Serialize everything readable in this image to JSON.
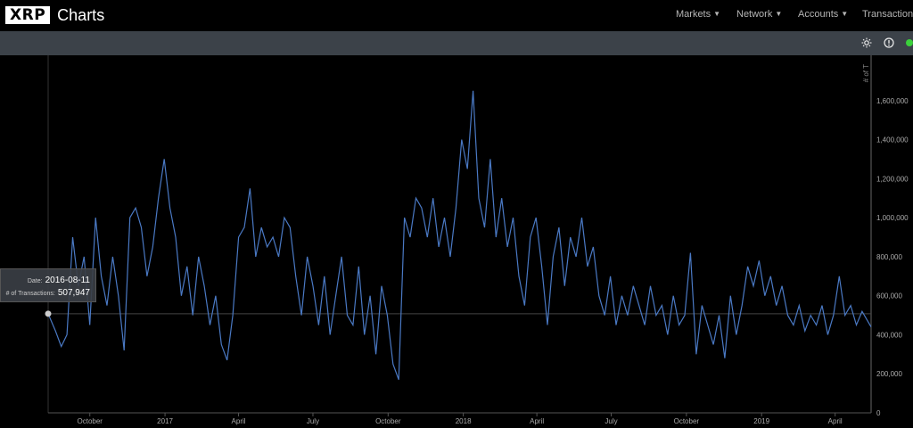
{
  "header": {
    "logo_mark": "XRP",
    "logo_text": "Charts",
    "nav": [
      {
        "label": "Markets"
      },
      {
        "label": "Network"
      },
      {
        "label": "Accounts"
      },
      {
        "label": "Transactions"
      }
    ]
  },
  "toolbar": {
    "icons": [
      "brightness-icon",
      "info-icon"
    ],
    "status_color": "#3bd13b"
  },
  "tooltip": {
    "date_label": "Date:",
    "date_value": "2016-08-11",
    "count_label": "# of Transactions:",
    "count_value": "507,947"
  },
  "chart_data": {
    "type": "line",
    "line_color": "#4a79c4",
    "ylabel": "# of T",
    "ylim": [
      0,
      1800000
    ],
    "y_ticks": [
      0,
      200000,
      400000,
      600000,
      800000,
      1000000,
      1200000,
      1400000,
      1600000
    ],
    "y_tick_labels": [
      "0",
      "200,000",
      "400,000",
      "600,000",
      "800,000",
      "1,000,000",
      "1,200,000",
      "1,400,000",
      "1,600,000"
    ],
    "xlim": [
      "2016-08-11",
      "2019-05-15"
    ],
    "x_ticks": [
      {
        "date": "2016-10-01",
        "label": "October"
      },
      {
        "date": "2017-01-01",
        "label": "2017"
      },
      {
        "date": "2017-04-01",
        "label": "April"
      },
      {
        "date": "2017-07-01",
        "label": "July"
      },
      {
        "date": "2017-10-01",
        "label": "October"
      },
      {
        "date": "2018-01-01",
        "label": "2018"
      },
      {
        "date": "2018-04-01",
        "label": "April"
      },
      {
        "date": "2018-07-01",
        "label": "July"
      },
      {
        "date": "2018-10-01",
        "label": "October"
      },
      {
        "date": "2019-01-01",
        "label": "2019"
      },
      {
        "date": "2019-04-01",
        "label": "April"
      }
    ],
    "crosshair": {
      "date": "2016-08-11",
      "value": 507947
    },
    "points": [
      [
        "2016-08-11",
        507947
      ],
      [
        "2016-08-20",
        420000
      ],
      [
        "2016-08-27",
        340000
      ],
      [
        "2016-09-03",
        400000
      ],
      [
        "2016-09-10",
        900000
      ],
      [
        "2016-09-17",
        650000
      ],
      [
        "2016-09-24",
        800000
      ],
      [
        "2016-10-01",
        450000
      ],
      [
        "2016-10-08",
        1000000
      ],
      [
        "2016-10-15",
        700000
      ],
      [
        "2016-10-22",
        550000
      ],
      [
        "2016-10-29",
        800000
      ],
      [
        "2016-11-05",
        600000
      ],
      [
        "2016-11-12",
        320000
      ],
      [
        "2016-11-19",
        1000000
      ],
      [
        "2016-11-26",
        1050000
      ],
      [
        "2016-12-03",
        950000
      ],
      [
        "2016-12-10",
        700000
      ],
      [
        "2016-12-17",
        850000
      ],
      [
        "2016-12-24",
        1100000
      ],
      [
        "2016-12-31",
        1300000
      ],
      [
        "2017-01-07",
        1050000
      ],
      [
        "2017-01-14",
        900000
      ],
      [
        "2017-01-21",
        600000
      ],
      [
        "2017-01-28",
        750000
      ],
      [
        "2017-02-04",
        500000
      ],
      [
        "2017-02-11",
        800000
      ],
      [
        "2017-02-18",
        650000
      ],
      [
        "2017-02-25",
        450000
      ],
      [
        "2017-03-04",
        600000
      ],
      [
        "2017-03-11",
        350000
      ],
      [
        "2017-03-18",
        270000
      ],
      [
        "2017-03-25",
        500000
      ],
      [
        "2017-04-01",
        900000
      ],
      [
        "2017-04-08",
        950000
      ],
      [
        "2017-04-15",
        1150000
      ],
      [
        "2017-04-22",
        800000
      ],
      [
        "2017-04-29",
        950000
      ],
      [
        "2017-05-06",
        850000
      ],
      [
        "2017-05-13",
        900000
      ],
      [
        "2017-05-20",
        800000
      ],
      [
        "2017-05-27",
        1000000
      ],
      [
        "2017-06-03",
        950000
      ],
      [
        "2017-06-10",
        700000
      ],
      [
        "2017-06-17",
        500000
      ],
      [
        "2017-06-24",
        800000
      ],
      [
        "2017-07-01",
        650000
      ],
      [
        "2017-07-08",
        450000
      ],
      [
        "2017-07-15",
        700000
      ],
      [
        "2017-07-22",
        400000
      ],
      [
        "2017-07-29",
        600000
      ],
      [
        "2017-08-05",
        800000
      ],
      [
        "2017-08-12",
        500000
      ],
      [
        "2017-08-19",
        450000
      ],
      [
        "2017-08-26",
        750000
      ],
      [
        "2017-09-02",
        400000
      ],
      [
        "2017-09-09",
        600000
      ],
      [
        "2017-09-16",
        300000
      ],
      [
        "2017-09-23",
        650000
      ],
      [
        "2017-09-30",
        500000
      ],
      [
        "2017-10-07",
        250000
      ],
      [
        "2017-10-14",
        170000
      ],
      [
        "2017-10-21",
        1000000
      ],
      [
        "2017-10-28",
        900000
      ],
      [
        "2017-11-04",
        1100000
      ],
      [
        "2017-11-11",
        1050000
      ],
      [
        "2017-11-18",
        900000
      ],
      [
        "2017-11-25",
        1100000
      ],
      [
        "2017-12-02",
        850000
      ],
      [
        "2017-12-09",
        1000000
      ],
      [
        "2017-12-16",
        800000
      ],
      [
        "2017-12-23",
        1050000
      ],
      [
        "2017-12-30",
        1400000
      ],
      [
        "2018-01-06",
        1250000
      ],
      [
        "2018-01-13",
        1650000
      ],
      [
        "2018-01-20",
        1100000
      ],
      [
        "2018-01-27",
        950000
      ],
      [
        "2018-02-03",
        1300000
      ],
      [
        "2018-02-10",
        900000
      ],
      [
        "2018-02-17",
        1100000
      ],
      [
        "2018-02-24",
        850000
      ],
      [
        "2018-03-03",
        1000000
      ],
      [
        "2018-03-10",
        700000
      ],
      [
        "2018-03-17",
        550000
      ],
      [
        "2018-03-24",
        900000
      ],
      [
        "2018-03-31",
        1000000
      ],
      [
        "2018-04-07",
        750000
      ],
      [
        "2018-04-14",
        450000
      ],
      [
        "2018-04-21",
        800000
      ],
      [
        "2018-04-28",
        950000
      ],
      [
        "2018-05-05",
        650000
      ],
      [
        "2018-05-12",
        900000
      ],
      [
        "2018-05-19",
        800000
      ],
      [
        "2018-05-26",
        1000000
      ],
      [
        "2018-06-02",
        750000
      ],
      [
        "2018-06-09",
        850000
      ],
      [
        "2018-06-16",
        600000
      ],
      [
        "2018-06-23",
        500000
      ],
      [
        "2018-06-30",
        700000
      ],
      [
        "2018-07-07",
        450000
      ],
      [
        "2018-07-14",
        600000
      ],
      [
        "2018-07-21",
        500000
      ],
      [
        "2018-07-28",
        650000
      ],
      [
        "2018-08-04",
        550000
      ],
      [
        "2018-08-11",
        450000
      ],
      [
        "2018-08-18",
        650000
      ],
      [
        "2018-08-25",
        500000
      ],
      [
        "2018-09-01",
        550000
      ],
      [
        "2018-09-08",
        400000
      ],
      [
        "2018-09-15",
        600000
      ],
      [
        "2018-09-22",
        450000
      ],
      [
        "2018-09-29",
        500000
      ],
      [
        "2018-10-06",
        820000
      ],
      [
        "2018-10-13",
        300000
      ],
      [
        "2018-10-20",
        550000
      ],
      [
        "2018-10-27",
        450000
      ],
      [
        "2018-11-03",
        350000
      ],
      [
        "2018-11-10",
        500000
      ],
      [
        "2018-11-17",
        280000
      ],
      [
        "2018-11-24",
        600000
      ],
      [
        "2018-12-01",
        400000
      ],
      [
        "2018-12-08",
        550000
      ],
      [
        "2018-12-15",
        750000
      ],
      [
        "2018-12-22",
        650000
      ],
      [
        "2018-12-29",
        780000
      ],
      [
        "2019-01-05",
        600000
      ],
      [
        "2019-01-12",
        700000
      ],
      [
        "2019-01-19",
        550000
      ],
      [
        "2019-01-26",
        650000
      ],
      [
        "2019-02-02",
        500000
      ],
      [
        "2019-02-09",
        450000
      ],
      [
        "2019-02-16",
        550000
      ],
      [
        "2019-02-23",
        420000
      ],
      [
        "2019-03-02",
        500000
      ],
      [
        "2019-03-09",
        450000
      ],
      [
        "2019-03-16",
        550000
      ],
      [
        "2019-03-23",
        400000
      ],
      [
        "2019-03-30",
        500000
      ],
      [
        "2019-04-06",
        700000
      ],
      [
        "2019-04-13",
        500000
      ],
      [
        "2019-04-20",
        550000
      ],
      [
        "2019-04-27",
        450000
      ],
      [
        "2019-05-04",
        520000
      ],
      [
        "2019-05-15",
        440000
      ]
    ]
  }
}
